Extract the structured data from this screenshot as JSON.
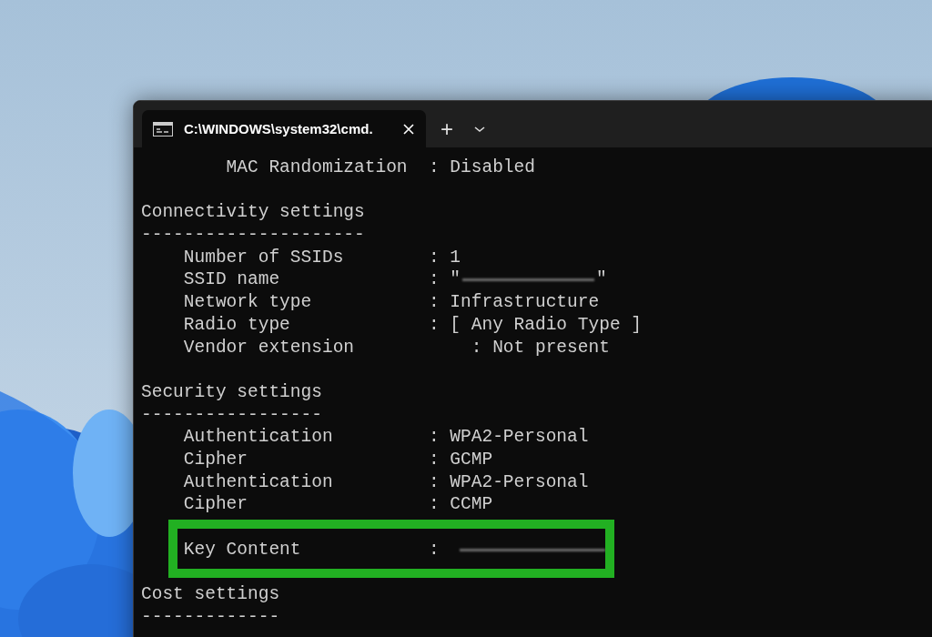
{
  "window": {
    "tab_title": "C:\\WINDOWS\\system32\\cmd.",
    "new_tab": "+"
  },
  "lines": [
    {
      "kind": "text",
      "text": "        MAC Randomization  : Disabled",
      "highlighted": false
    },
    {
      "kind": "blank"
    },
    {
      "kind": "heading",
      "text": "Connectivity settings",
      "highlighted": false
    },
    {
      "kind": "rule",
      "text": "---------------------",
      "highlighted": false
    },
    {
      "kind": "text",
      "text": "    Number of SSIDs        : 1",
      "highlighted": false
    },
    {
      "kind": "redacted",
      "text": "    SSID name              : \"",
      "after": "\"",
      "highlighted": false
    },
    {
      "kind": "text",
      "text": "    Network type           : Infrastructure",
      "highlighted": false
    },
    {
      "kind": "text",
      "text": "    Radio type             : [ Any Radio Type ]",
      "highlighted": false
    },
    {
      "kind": "text",
      "text": "    Vendor extension           : Not present",
      "highlighted": false
    },
    {
      "kind": "blank"
    },
    {
      "kind": "heading",
      "text": "Security settings",
      "highlighted": false
    },
    {
      "kind": "rule",
      "text": "-----------------",
      "highlighted": false
    },
    {
      "kind": "text",
      "text": "    Authentication         : WPA2-Personal",
      "highlighted": false
    },
    {
      "kind": "text",
      "text": "    Cipher                 : GCMP",
      "highlighted": false
    },
    {
      "kind": "text",
      "text": "    Authentication         : WPA2-Personal",
      "highlighted": false
    },
    {
      "kind": "text",
      "text": "    Cipher                 : CCMP",
      "highlighted": false
    },
    {
      "kind": "blank",
      "highlighted": true
    },
    {
      "kind": "redacted",
      "text": "    Key Content            :",
      "highlighted": true
    },
    {
      "kind": "blank"
    },
    {
      "kind": "heading",
      "text": "Cost settings",
      "highlighted": false
    },
    {
      "kind": "rule",
      "text": "-------------",
      "highlighted": false
    }
  ]
}
